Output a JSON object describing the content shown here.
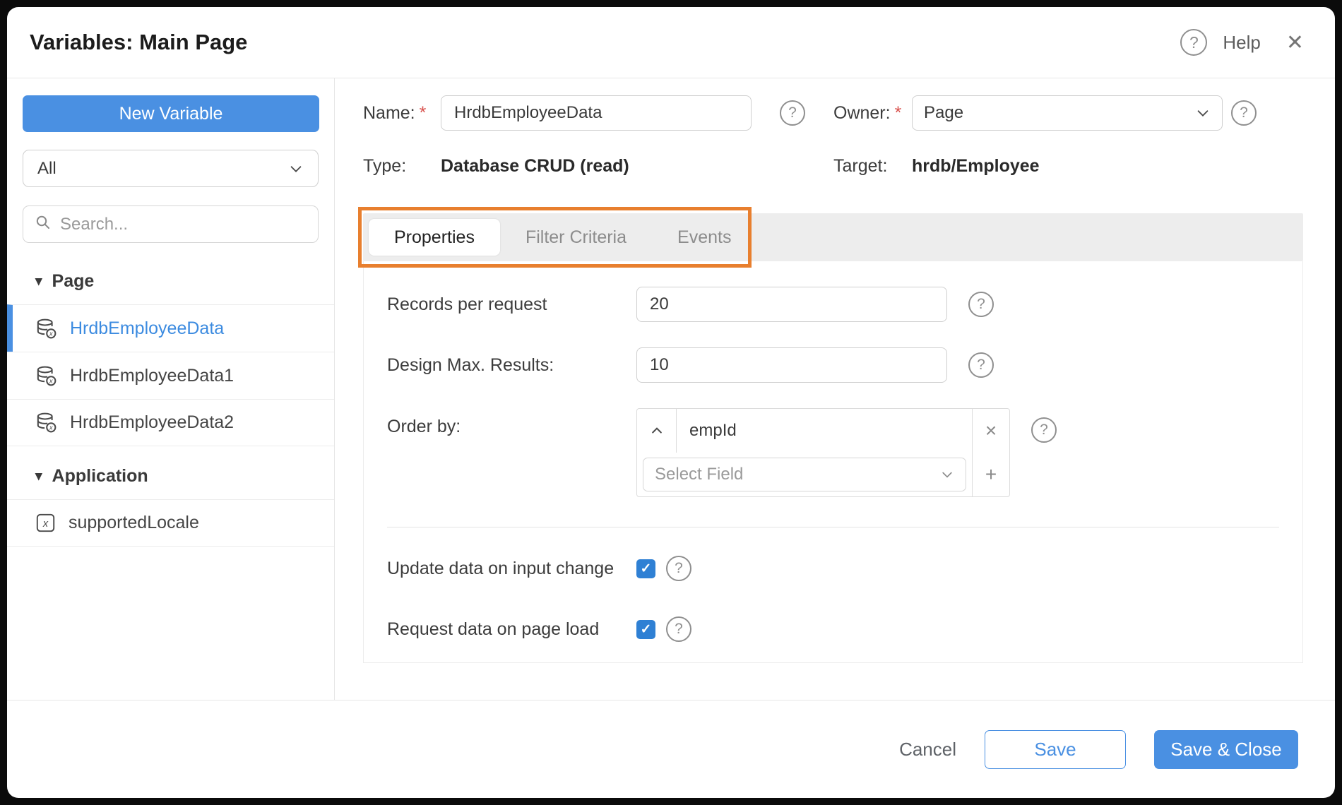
{
  "dialog": {
    "title": "Variables: Main Page",
    "help_label": "Help"
  },
  "colors": {
    "primary": "#4a90e2",
    "selected_text": "#3c8be0",
    "annotation": "#e87f2e",
    "checkbox": "#2f80d4"
  },
  "icons": {
    "help": "?",
    "close": "✕",
    "caret_down": "▾",
    "remove": "×",
    "add": "+",
    "check": "✓",
    "database": "database-cylinder-with-x-badge",
    "variable": "square-italic-x",
    "search": "magnifier",
    "chevron_down": "v-chevron",
    "sort_ascending": "up-chevron"
  },
  "sidebar": {
    "new_variable_label": "New Variable",
    "filter_value": "All",
    "search_placeholder": "Search...",
    "sections": [
      {
        "label": "Page",
        "items": [
          {
            "name": "HrdbEmployeeData",
            "icon": "database",
            "selected": true
          },
          {
            "name": "HrdbEmployeeData1",
            "icon": "database",
            "selected": false
          },
          {
            "name": "HrdbEmployeeData2",
            "icon": "database",
            "selected": false
          }
        ]
      },
      {
        "label": "Application",
        "items": [
          {
            "name": "supportedLocale",
            "icon": "variable",
            "selected": false
          }
        ]
      }
    ]
  },
  "form": {
    "name": {
      "label": "Name:",
      "required": "*",
      "value": "HrdbEmployeeData"
    },
    "owner": {
      "label": "Owner:",
      "required": "*",
      "value": "Page"
    },
    "type": {
      "label": "Type:",
      "value": "Database CRUD (read)"
    },
    "target": {
      "label": "Target:",
      "value": "hrdb/Employee"
    }
  },
  "tabs": [
    {
      "label": "Properties",
      "active": true
    },
    {
      "label": "Filter Criteria",
      "active": false
    },
    {
      "label": "Events",
      "active": false
    }
  ],
  "properties": {
    "records": {
      "label": "Records per request",
      "value": "20"
    },
    "max_results": {
      "label": "Design Max. Results:",
      "value": "10"
    },
    "order_by": {
      "label": "Order by:",
      "field": "empId",
      "select_placeholder": "Select Field"
    },
    "update_on_input": {
      "label": "Update data on input change",
      "checked": true
    },
    "request_on_load": {
      "label": "Request data on page load",
      "checked": true
    }
  },
  "footer": {
    "cancel_label": "Cancel",
    "save_label": "Save",
    "save_close_label": "Save & Close"
  }
}
